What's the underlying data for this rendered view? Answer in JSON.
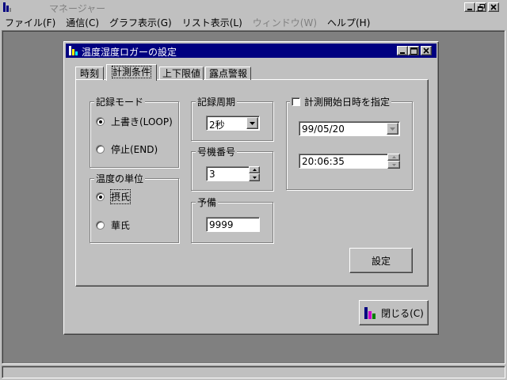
{
  "app": {
    "title_suffix": "マネージャー"
  },
  "menu": [
    "ファイル(F)",
    "通信(C)",
    "グラフ表示(G)",
    "リスト表示(L)",
    "ウィンドウ(W)",
    "ヘルプ(H)"
  ],
  "dialog": {
    "title": "温度湿度ロガーの設定",
    "tabs": [
      "時刻",
      "計測条件",
      "上下限値",
      "露点警報"
    ],
    "record_mode": {
      "title": "記録モード",
      "options": [
        "上書き(LOOP)",
        "停止(END)"
      ],
      "selected": 0
    },
    "temp_unit": {
      "title": "温度の単位",
      "options": [
        "摂氏",
        "華氏"
      ],
      "selected": 0
    },
    "record_period": {
      "title": "記録周期",
      "value": "2秒"
    },
    "unit_number": {
      "title": "号機番号",
      "value": "3"
    },
    "reserve": {
      "title": "予備",
      "value": "9999"
    },
    "start_datetime": {
      "title": "計測開始日時を指定",
      "checked": false,
      "date": "99/05/20",
      "time": "20:06:35"
    },
    "set_button": "設定",
    "close_button": "閉じる(C)"
  }
}
